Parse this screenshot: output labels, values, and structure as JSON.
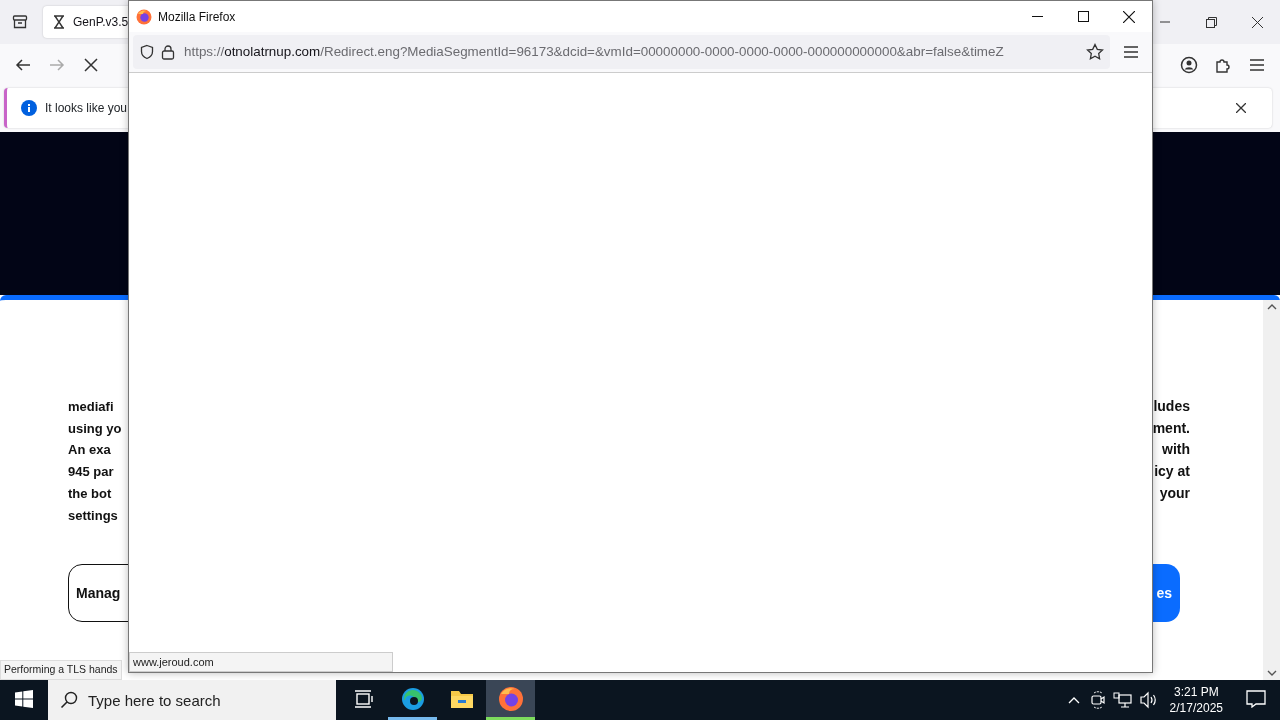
{
  "background_browser": {
    "tabs": [
      {
        "label": "GenP.v3.5",
        "selected": true
      }
    ],
    "notification": {
      "text": "It looks like you"
    },
    "page": {
      "left_lines": [
        "mediafi",
        "using yo",
        "An exa",
        "945 par",
        "the bot",
        "settings"
      ],
      "right_lines": [
        "ludes",
        "ment.",
        "with",
        "icy at",
        "your"
      ],
      "buttons": [
        {
          "label": "Manag",
          "kind": "outline"
        },
        {
          "label": "es",
          "kind": "primary"
        }
      ]
    },
    "status": "Performing a TLS hands"
  },
  "popup": {
    "title": "Mozilla Firefox",
    "url_scheme": "https://",
    "url_host": "otnolatrnup.com",
    "url_path": "/Redirect.eng?MediaSegmentId=96173&dcid=&vmId=00000000-0000-0000-0000-000000000000&abr=false&timeZ",
    "status_link": "www.jeroud.com"
  },
  "taskbar": {
    "search_placeholder": "Type here to search",
    "apps": [
      {
        "kind": "edge",
        "running": true,
        "selected": false
      },
      {
        "kind": "explorer",
        "running": false,
        "selected": false
      },
      {
        "kind": "firefox",
        "running": true,
        "selected": true
      }
    ],
    "time": "3:21 PM",
    "date": "2/17/2025"
  }
}
